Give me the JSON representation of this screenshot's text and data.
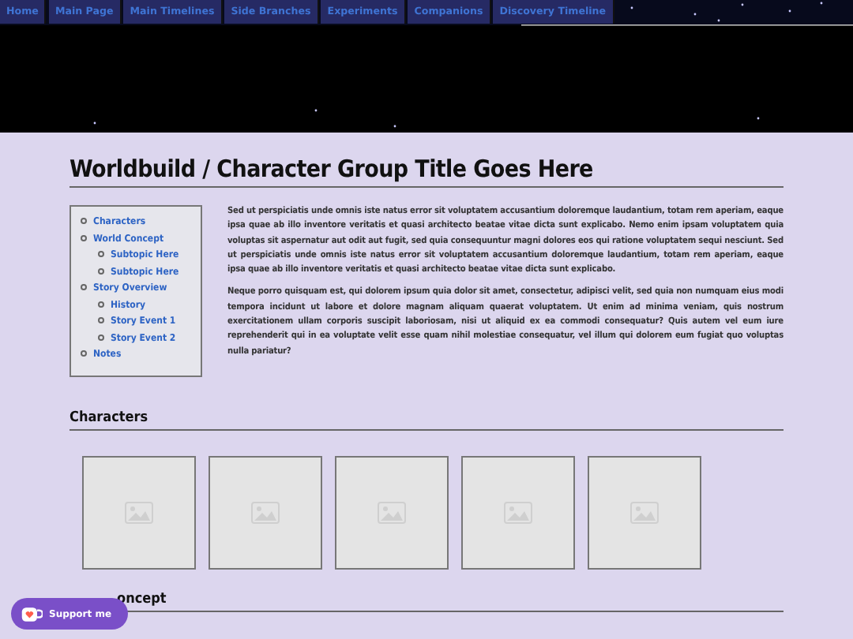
{
  "nav": {
    "tabs": [
      {
        "label": "Home"
      },
      {
        "label": "Main Page"
      },
      {
        "label": "Main Timelines"
      },
      {
        "label": "Side Branches"
      },
      {
        "label": "Experiments"
      },
      {
        "label": "Companions"
      },
      {
        "label": "Discovery Timeline"
      }
    ]
  },
  "header": {
    "kind": "picture"
  },
  "title": "Worldbuild / Character Group Title Goes Here",
  "toc": [
    {
      "label": "Characters"
    },
    {
      "label": "World Concept",
      "children": [
        {
          "label": "Subtopic Here"
        },
        {
          "label": "Subtopic Here"
        }
      ]
    },
    {
      "label": "Story Overview",
      "children": [
        {
          "label": "History"
        },
        {
          "label": "Story Event 1"
        },
        {
          "label": "Story Event 2"
        }
      ]
    },
    {
      "label": "Notes"
    }
  ],
  "paragraphs": [
    "Sed ut perspiciatis unde omnis iste natus error sit voluptatem accusantium doloremque laudantium, totam rem aperiam, eaque ipsa quae ab illo inventore veritatis et quasi architecto beatae vitae dicta sunt explicabo. Nemo enim ipsam voluptatem quia voluptas sit aspernatur aut odit aut fugit, sed quia consequuntur magni dolores eos qui ratione voluptatem sequi nesciunt. Sed ut perspiciatis unde omnis iste natus error sit voluptatem accusantium doloremque laudantium, totam rem aperiam, eaque ipsa quae ab illo inventore veritatis et quasi architecto beatae vitae dicta sunt explicabo.",
    "Neque porro quisquam est, qui dolorem ipsum quia dolor sit amet, consectetur, adipisci velit, sed quia non numquam eius modi tempora incidunt ut labore et dolore magnam aliquam quaerat voluptatem. Ut enim ad minima veniam, quis nostrum exercitationem ullam corporis suscipit laboriosam, nisi ut aliquid ex ea commodi consequatur? Quis autem vel eum iure reprehenderit qui in ea voluptate velit esse quam nihil molestiae consequatur, vel illum qui dolorem eum fugiat quo voluptas nulla pariatur?"
  ],
  "sections": [
    {
      "heading": "Characters",
      "images": [
        {
          "kind": "placeholder"
        },
        {
          "kind": "placeholder"
        },
        {
          "kind": "placeholder"
        },
        {
          "kind": "placeholder"
        },
        {
          "kind": "placeholder"
        }
      ]
    },
    {
      "heading": "oncept"
    }
  ],
  "support_button": {
    "label": "Support me"
  }
}
